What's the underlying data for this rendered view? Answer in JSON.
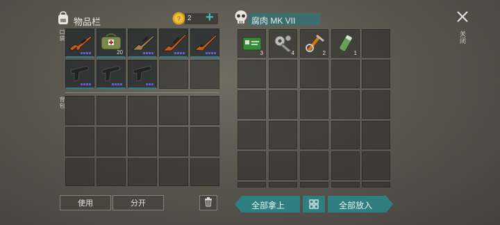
{
  "inventory": {
    "title": "物品栏",
    "pocket_label": "口袋",
    "backpack_label": "背包",
    "coins": "2",
    "plus": "+"
  },
  "pocket_items": [
    {
      "icon": "rifle-icon",
      "color": "#c85a1a",
      "dots": 4
    },
    {
      "icon": "medical-bag-icon",
      "color": "#7a8a4a",
      "qty": "20"
    },
    {
      "icon": "scoped-rifle-icon",
      "color": "#a08050",
      "dots": 4
    },
    {
      "icon": "sniper-rifle-icon",
      "color": "#c85a1a",
      "dots": 4
    },
    {
      "icon": "shotgun-icon",
      "color": "#c85a1a",
      "dots": 4
    },
    {
      "icon": "pistol-icon",
      "color": "#222",
      "dots": 4
    },
    {
      "icon": "pistol-icon",
      "color": "#222",
      "dots": 4
    },
    {
      "icon": "pistol-icon",
      "color": "#222",
      "dots": 3
    }
  ],
  "container": {
    "name": "腐肉 MK VII",
    "close_label": "关闭"
  },
  "container_items": [
    {
      "icon": "keycard-icon",
      "color": "#3a8a3a",
      "qty": "3"
    },
    {
      "icon": "mechanical-parts-icon",
      "color": "#bbb",
      "qty": "4"
    },
    {
      "icon": "tools-icon",
      "color": "#d07a20",
      "qty": "2"
    },
    {
      "icon": "vial-icon",
      "color": "#6aa05a",
      "qty": "1"
    }
  ],
  "actions": {
    "use": "使用",
    "split": "分开",
    "take_all": "全部拿上",
    "put_all": "全部放入"
  }
}
